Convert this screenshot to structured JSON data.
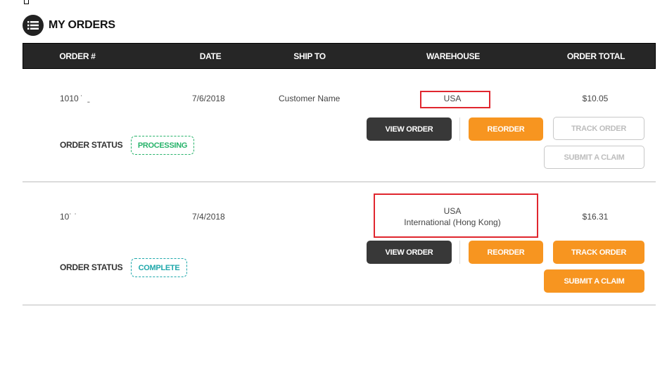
{
  "page": {
    "title": "MY ORDERS",
    "title_icon": "list-icon"
  },
  "table": {
    "columns": [
      "ORDER #",
      "DATE",
      "SHIP TO",
      "WAREHOUSE",
      "ORDER TOTAL"
    ]
  },
  "orders": [
    {
      "order_number": "1010 ˙  ˍ ",
      "date": "7/6/2018",
      "ship_to": "Customer Name",
      "warehouse_lines": [
        "USA"
      ],
      "order_total": "$10.05",
      "status_label": "ORDER STATUS",
      "status": "PROCESSING",
      "status_color": "#27b36a",
      "buttons": {
        "view": "VIEW ORDER",
        "reorder": "REORDER",
        "track": "TRACK ORDER",
        "claim": "SUBMIT A CLAIM"
      },
      "track_enabled": false,
      "claim_enabled": false
    },
    {
      "order_number": "10˙ ˙",
      "date": "7/4/2018",
      "ship_to": "",
      "warehouse_lines": [
        "USA",
        "International (Hong Kong)"
      ],
      "order_total": "$16.31",
      "status_label": "ORDER STATUS",
      "status": "COMPLETE",
      "status_color": "#1fa8ab",
      "buttons": {
        "view": "VIEW ORDER",
        "reorder": "REORDER",
        "track": "TRACK ORDER",
        "claim": "SUBMIT A CLAIM"
      },
      "track_enabled": true,
      "claim_enabled": true
    }
  ],
  "colors": {
    "header_bg": "#262626",
    "primary_orange": "#f79520",
    "dark_button": "#383838",
    "highlight_red": "#e0262e"
  }
}
